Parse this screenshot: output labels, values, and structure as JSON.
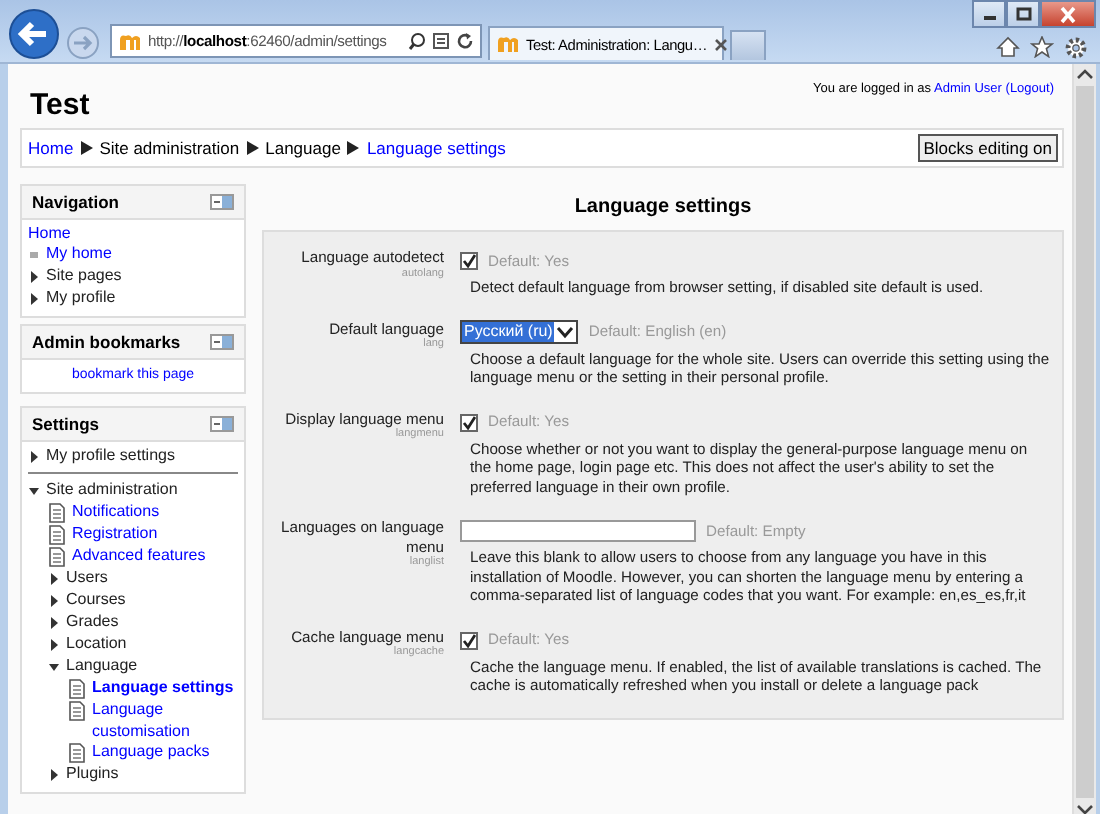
{
  "browser": {
    "address": "http://**localhost**:62460/admin/settings",
    "tab_title": "Test: Administration: Langu…"
  },
  "header": {
    "site_name": "Test",
    "login_prefix": "You are logged in as",
    "user": "Admin User",
    "logout": "(Logout)"
  },
  "breadcrumb": [
    {
      "label": "Home",
      "link": true
    },
    {
      "label": "Site administration",
      "link": false
    },
    {
      "label": "Language",
      "link": false
    },
    {
      "label": "Language settings",
      "link": true
    }
  ],
  "edit_button": "Blocks editing on",
  "navigation": {
    "title": "Navigation",
    "items": [
      {
        "label": "Home",
        "kind": "link"
      },
      {
        "label": "My home",
        "kind": "bullet"
      },
      {
        "label": "Site pages",
        "kind": "folder",
        "expanded": false
      },
      {
        "label": "My profile",
        "kind": "folder",
        "expanded": false
      }
    ]
  },
  "bookmarks": {
    "title": "Admin bookmarks",
    "link": "bookmark this page"
  },
  "settings_block": {
    "title": "Settings",
    "items": [
      {
        "label": "My profile settings",
        "kind": "folder",
        "expanded": false
      },
      {
        "label": "Site administration",
        "kind": "folder",
        "expanded": true,
        "children": [
          {
            "label": "Notifications",
            "kind": "page",
            "selected": false
          },
          {
            "label": "Registration",
            "kind": "page",
            "selected": false
          },
          {
            "label": "Advanced features",
            "kind": "page",
            "selected": false
          },
          {
            "label": "Users",
            "kind": "folder",
            "expanded": false
          },
          {
            "label": "Courses",
            "kind": "folder",
            "expanded": false
          },
          {
            "label": "Grades",
            "kind": "folder",
            "expanded": false
          },
          {
            "label": "Location",
            "kind": "folder",
            "expanded": false
          },
          {
            "label": "Language",
            "kind": "folder",
            "expanded": true,
            "children": [
              {
                "label": "Language settings",
                "kind": "page",
                "selected": true
              },
              {
                "label": "Language customisation",
                "kind": "page",
                "selected": false
              },
              {
                "label": "Language packs",
                "kind": "page",
                "selected": false
              }
            ]
          },
          {
            "label": "Plugins",
            "kind": "folder",
            "expanded": false
          }
        ]
      }
    ]
  },
  "main": {
    "heading": "Language settings",
    "settings": [
      {
        "kind": "checkbox",
        "label": "Language autodetect",
        "name": "autolang",
        "checked": true,
        "default": "Default: Yes",
        "description": "Detect default language from browser setting, if disabled site default is used."
      },
      {
        "kind": "select",
        "label": "Default language",
        "name": "lang",
        "value": "Русский (ru)",
        "default": "Default: English (en)",
        "description": "Choose a default language for the whole site. Users can override this setting using the language menu or the setting in their personal profile."
      },
      {
        "kind": "checkbox",
        "label": "Display language menu",
        "name": "langmenu",
        "checked": true,
        "default": "Default: Yes",
        "description": "Choose whether or not you want to display the general-purpose language menu on the home page, login page etc. This does not affect the user's ability to set the preferred language in their own profile."
      },
      {
        "kind": "text",
        "label": "Languages on language menu",
        "name": "langlist",
        "default": "Default: Empty",
        "description": "Leave this blank to allow users to choose from any language you have in this installation of Moodle. However, you can shorten the language menu by entering a comma-separated list of language codes that you want. For example: en,es_es,fr,it"
      },
      {
        "kind": "checkbox",
        "label": "Cache language menu",
        "name": "langcache",
        "checked": true,
        "default": "Default: Yes",
        "description": "Cache the language menu. If enabled, the list of available translations is cached. The cache is automatically refreshed when you install or delete a language pack"
      }
    ]
  }
}
